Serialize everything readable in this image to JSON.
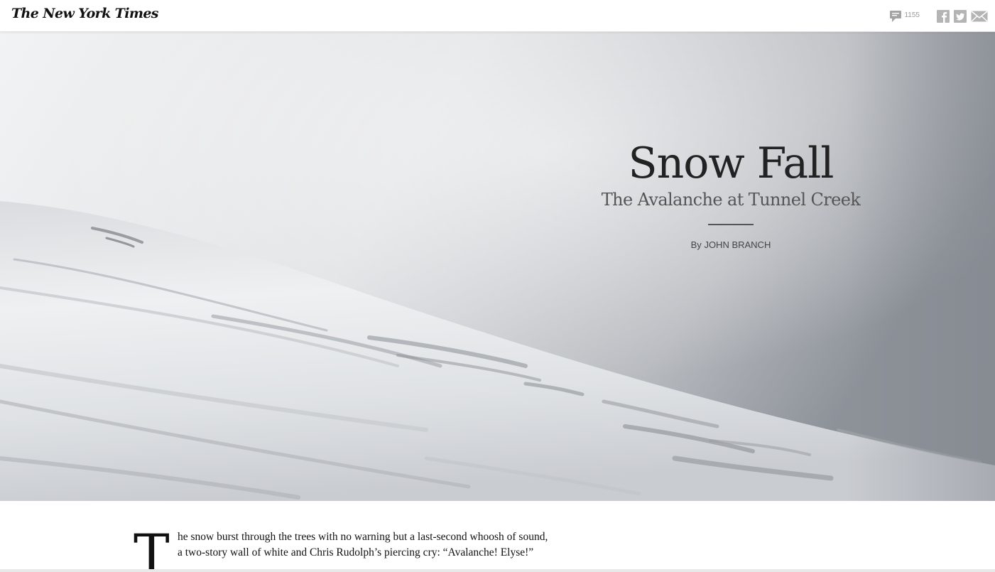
{
  "header": {
    "logo_text": "The New York Times",
    "comment_count": "1155",
    "icons": {
      "comments": "comment-bubble-icon",
      "facebook": "facebook-icon",
      "twitter": "twitter-icon",
      "email": "email-icon"
    }
  },
  "hero": {
    "headline": "Snow Fall",
    "subhead": "The Avalanche at Tunnel Creek",
    "byline_prefix": "By",
    "author": "JOHN BRANCH"
  },
  "story": {
    "dropcap": "T",
    "lede_lines": [
      "he snow burst through the trees with no warning but a last-second whoosh of sound,",
      "a two-story wall of white and Chris Rudolph’s piercing cry: “Avalanche! Elyse!”"
    ]
  },
  "colors": {
    "sky_light": "#eef0f1",
    "sky_dark": "#8f949c",
    "snow": "#f3f4f5",
    "text": "#222222"
  }
}
